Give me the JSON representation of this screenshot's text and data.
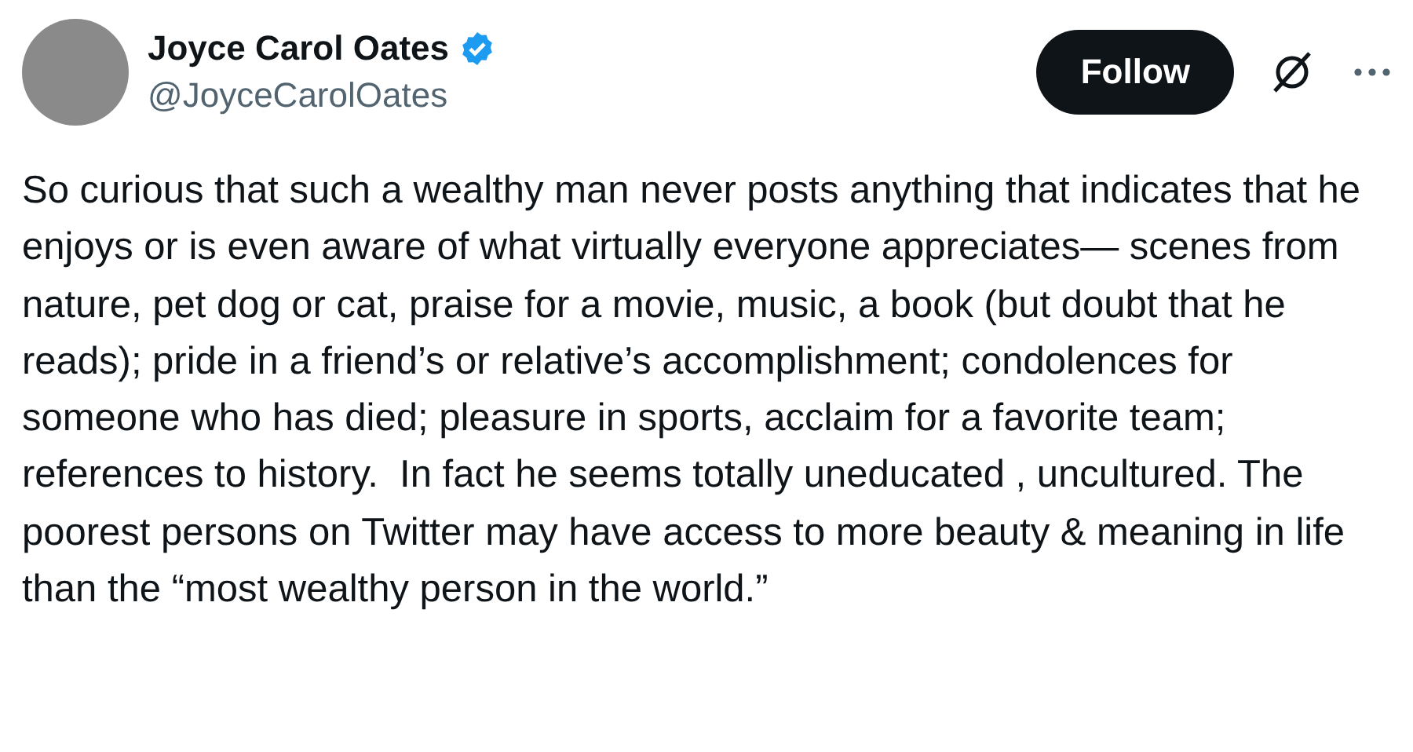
{
  "author": {
    "name": "Joyce Carol Oates",
    "verified": true,
    "handle": "@JoyceCarolOates"
  },
  "follow_button": {
    "label": "Follow"
  },
  "post": {
    "text": "So curious that such a wealthy man never posts anything that indicates that he enjoys or is even aware of what virtually everyone appreciates— scenes from nature, pet dog or cat, praise for a movie, music, a book (but doubt that he reads); pride in a friend’s or relative’s accomplishment; condolences for someone who has died; pleasure in sports, acclaim for a favorite team;  references to history.  In fact he seems totally uneducated , uncultured. The poorest persons on Twitter may have access to more beauty & meaning in life than the “most wealthy person in the world.”"
  }
}
